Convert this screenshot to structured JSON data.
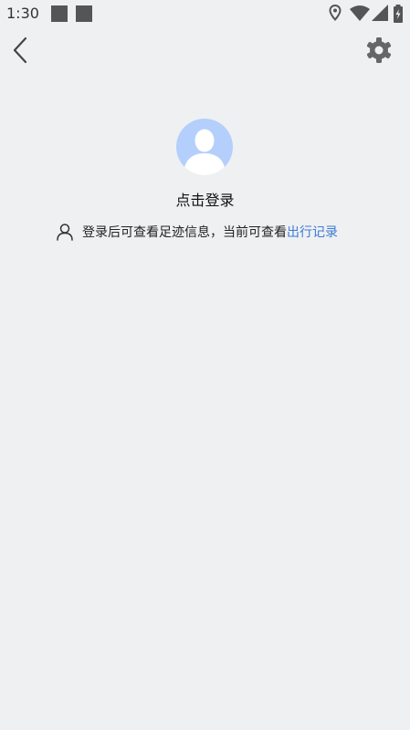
{
  "status_bar": {
    "time": "1:30"
  },
  "header": {
    "back_icon": "chevron-left-icon",
    "settings_icon": "gear-icon"
  },
  "profile": {
    "avatar_icon": "default-avatar-icon",
    "login_label": "点击登录",
    "hint_text": "登录后可查看足迹信息，当前可查看",
    "hint_link": "出行记录",
    "colors": {
      "avatar_bg": "#b4cffb",
      "link": "#3c7bd6",
      "page_bg": "#eff0f2"
    }
  }
}
